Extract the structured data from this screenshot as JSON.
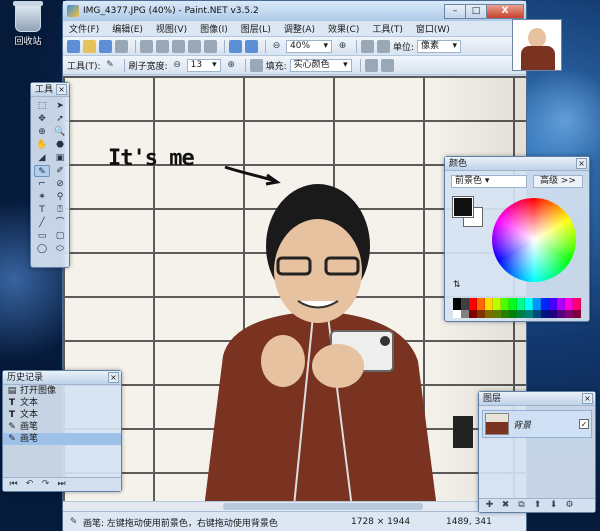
{
  "desktop": {
    "recycle_bin_label": "回收站"
  },
  "window": {
    "title": "IMG_4377.JPG (40%) - Paint.NET v3.5.2",
    "buttons": {
      "minimize": "–",
      "maximize": "□",
      "close": "X"
    }
  },
  "menu": {
    "items": [
      "文件(F)",
      "编辑(E)",
      "视图(V)",
      "图像(I)",
      "图层(L)",
      "调整(A)",
      "效果(C)",
      "工具(T)",
      "窗口(W)"
    ],
    "help": "?"
  },
  "toolbar1": {
    "zoom_value": "40%",
    "units_label": "单位:",
    "units_value": "像素"
  },
  "toolbar2": {
    "tool_label": "工具(T):",
    "brush_width_label": "刷子宽度:",
    "brush_width_value": "13",
    "fill_label": "填充:",
    "fill_value": "实心颜色"
  },
  "canvas": {
    "annotation_text": "It's me"
  },
  "status": {
    "hint": "画笔: 左键拖动使用前景色，右键拖动使用背景色",
    "image_size": "1728 × 1944",
    "cursor_pos": "1489, 341"
  },
  "tools_panel": {
    "title": "工具",
    "tools": [
      "⬚",
      "➤",
      "✥",
      "➚",
      "⊕",
      "🔍",
      "✋",
      "⬣",
      "◢",
      "▣",
      "✎",
      "✐",
      "⌐",
      "⊘",
      "✶",
      "⚲",
      "T",
      "⍰",
      "╱",
      "⌒",
      "▭",
      "▢",
      "◯",
      "⬭"
    ]
  },
  "colors_panel": {
    "title": "颜色",
    "primary_select": "前景色",
    "more_button": "高级 >>",
    "palette": [
      "#000000",
      "#404040",
      "#ff0000",
      "#ff6a00",
      "#ffd800",
      "#b6ff00",
      "#4cff00",
      "#00ff21",
      "#00ff90",
      "#00ffff",
      "#0094ff",
      "#0026ff",
      "#4800ff",
      "#b200ff",
      "#ff00dc",
      "#ff006e"
    ],
    "palette2": [
      "#ffffff",
      "#808080",
      "#7f0000",
      "#7f3300",
      "#7f6a00",
      "#5b7f00",
      "#267f00",
      "#007f0e",
      "#007f46",
      "#007f7f",
      "#004a7f",
      "#00137f",
      "#21007f",
      "#57007f",
      "#7f006e",
      "#7f0037"
    ]
  },
  "history_panel": {
    "title": "历史记录",
    "items": [
      {
        "glyph": "▤",
        "label": "打开图像"
      },
      {
        "glyph": "T",
        "label": "文本"
      },
      {
        "glyph": "T",
        "label": "文本"
      },
      {
        "glyph": "✎",
        "label": "画笔"
      },
      {
        "glyph": "✎",
        "label": "画笔"
      }
    ],
    "footer": [
      "⏮",
      "↶",
      "↷",
      "⏭"
    ]
  },
  "layers_panel": {
    "title": "图层",
    "layer_name": "背景",
    "footer": [
      "✚",
      "✖",
      "⧉",
      "⬆",
      "⬇",
      "⚙"
    ]
  }
}
